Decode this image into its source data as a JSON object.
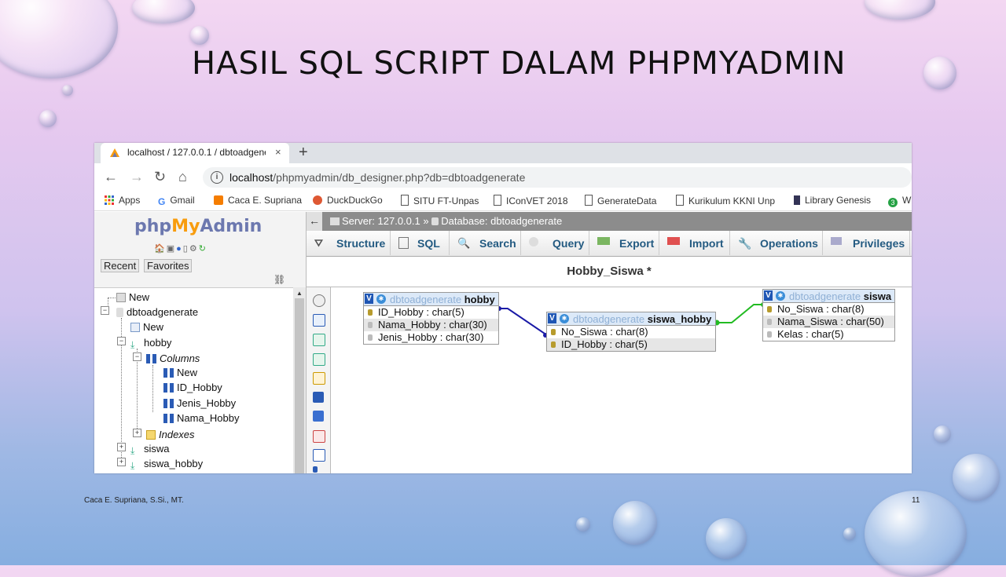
{
  "slide": {
    "title": "HASIL SQL SCRIPT DALAM PHPMYADMIN",
    "footer_left": "Caca E. Supriana, S.Si., MT.",
    "page_number": "11"
  },
  "browser": {
    "tab_title": "localhost / 127.0.0.1 / dbtoadgenerate",
    "tab_close": "×",
    "new_tab": "+",
    "url_host": "localhost",
    "url_path": "/phpmyadmin/db_designer.php?db=dbtoadgenerate",
    "bookmarks": [
      "Apps",
      "Gmail",
      "Caca E. Supriana",
      "DuckDuckGo",
      "SITU FT-Unpas",
      "IConVET 2018",
      "GenerateData",
      "Kurikulum KKNI Unp",
      "Library Genesis",
      "W"
    ]
  },
  "pma": {
    "logo_php": "php",
    "logo_my": "My",
    "logo_admin": "Admin",
    "recent": "Recent",
    "favorites": "Favorites",
    "tree": {
      "new_top": "New",
      "db": "dbtoadgenerate",
      "new_db": "New",
      "hobby": "hobby",
      "columns": "Columns",
      "new_col": "New",
      "cols": [
        "ID_Hobby",
        "Jenis_Hobby",
        "Nama_Hobby"
      ],
      "indexes": "Indexes",
      "siswa": "siswa",
      "siswa_hobby": "siswa_hobby"
    },
    "breadcrumb": {
      "server": "Server: 127.0.0.1",
      "sep": "»",
      "database": "Database: dbtoadgenerate"
    },
    "menu": [
      "Structure",
      "SQL",
      "Search",
      "Query",
      "Export",
      "Import",
      "Operations",
      "Privileges"
    ],
    "designer_title": "Hobby_Siswa *",
    "tables": {
      "hobby": {
        "db": "dbtoadgenerate",
        "name": "hobby",
        "rows": [
          "ID_Hobby : char(5)",
          "Nama_Hobby : char(30)",
          "Jenis_Hobby : char(30)"
        ]
      },
      "siswa_hobby": {
        "db": "dbtoadgenerate",
        "name": "siswa_hobby",
        "rows": [
          "No_Siswa : char(8)",
          "ID_Hobby : char(5)"
        ]
      },
      "siswa": {
        "db": "dbtoadgenerate",
        "name": "siswa",
        "rows": [
          "No_Siswa : char(8)",
          "Nama_Siswa : char(50)",
          "Kelas : char(5)"
        ]
      }
    },
    "colors": {
      "relation_blue": "#1a1aa6",
      "relation_green": "#22bb22",
      "menu_text": "#235a81"
    }
  }
}
